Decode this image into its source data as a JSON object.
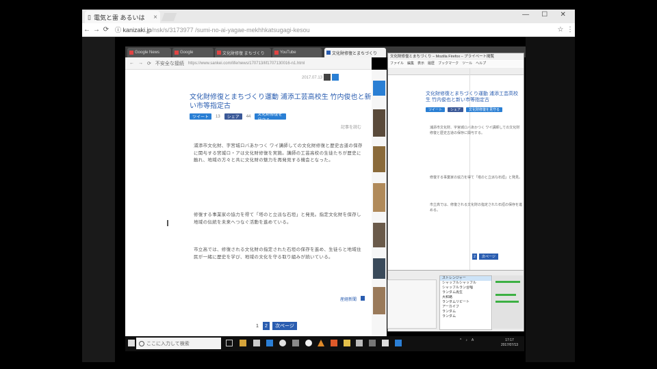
{
  "outer_browser": {
    "tab_title": "電気と雷 あるいは",
    "window_controls": [
      "—",
      "☐",
      "✕"
    ],
    "url_domain": "kanizaki.jp",
    "url_path": "/nsk/s/3173977 /sumi-no-ai-yagae-mekhhkatsugagi-kesou"
  },
  "inner_browser": {
    "tabs": [
      {
        "label": "Google News"
      },
      {
        "label": "Google"
      },
      {
        "label": "文化財修復 まちづくり"
      },
      {
        "label": "YouTube"
      },
      {
        "label": "文化財修復とまちづくり"
      }
    ],
    "address_prefix": "不安全な接続",
    "address": "https://www.sankei.com/life/news/170713/lif1707130016-n1.html"
  },
  "article": {
    "date_label": "2017.07.13",
    "title": "文化財修復とまちづくり運動 浦添工芸高校生 竹内俊也と新い市等指定古",
    "social": {
      "tweet": "ツイート",
      "tweet_count": "13",
      "facebook": "シェア",
      "fb_count": "44",
      "feature": "文化財修復を見守る"
    },
    "sub_note": "記事を読む",
    "paragraphs": [
      "浦添市文化財、字宮城ロバあかつく ワイ講師しての文化財修復と歴史古道の保存に関与する宮城ロ・アは文化財修復を実施。講師の工芸高校の生徒たちが歴史に触れ、地域の方々と共に文化財の魅力を再発見する機会となった。",
      "修復する事業家の協力を得て「塔のと立派な石垣」と発見。指定文化財を保存し地域の伝統を未来へつなぐ活動を進めている。",
      "市立高では、修復される文化財の指定された石垣の保存を進め、生徒らと地域住民が一緒に歴史を学び、地域の文化を守る取り組みが続いている。"
    ],
    "source_link": "産経新聞",
    "pager": {
      "page1": "1",
      "page2": "2",
      "next": "次ページ"
    }
  },
  "second_window": {
    "title": "文化財修復とまちづくり – Mozilla Firefox – プライベート閲覧",
    "menu": [
      "ファイル",
      "編集",
      "表示",
      "履歴",
      "ブックマーク",
      "ツール",
      "ヘルプ"
    ],
    "article_title": "文化財修復とまちづくり運動 浦添工芸高校生 竹内俊也と新い市等指定古",
    "paragraphs": [
      "浦添市文化財、字宮城ロバあかつく ワイ講師しての文化財修復と歴史古道の保存に関与する。",
      "修復する事業家の協力を得て「塔のと立派な石垣」と発見。",
      "市立高では、修復される文化財の指定された石垣の保存を進める。"
    ],
    "pager": {
      "page2": "2",
      "next": "次ページ"
    },
    "panel_items": [
      "ストレンジャー",
      "シャッフルシャッフル",
      "シャッフルラン合唱",
      "ランダム再生",
      "大和路",
      "ランダムリピート",
      "アーカイブ",
      "ランダム",
      "ランダム"
    ]
  },
  "taskbar": {
    "search_placeholder": "ここに入力して検索",
    "clock_time": "17:17",
    "clock_date": "2017/07/13",
    "tray_items": [
      "^",
      "♪",
      "A"
    ]
  },
  "colors": {
    "accent": "#2a5db0",
    "taskbar": "#101010",
    "green": "#3cb043"
  }
}
